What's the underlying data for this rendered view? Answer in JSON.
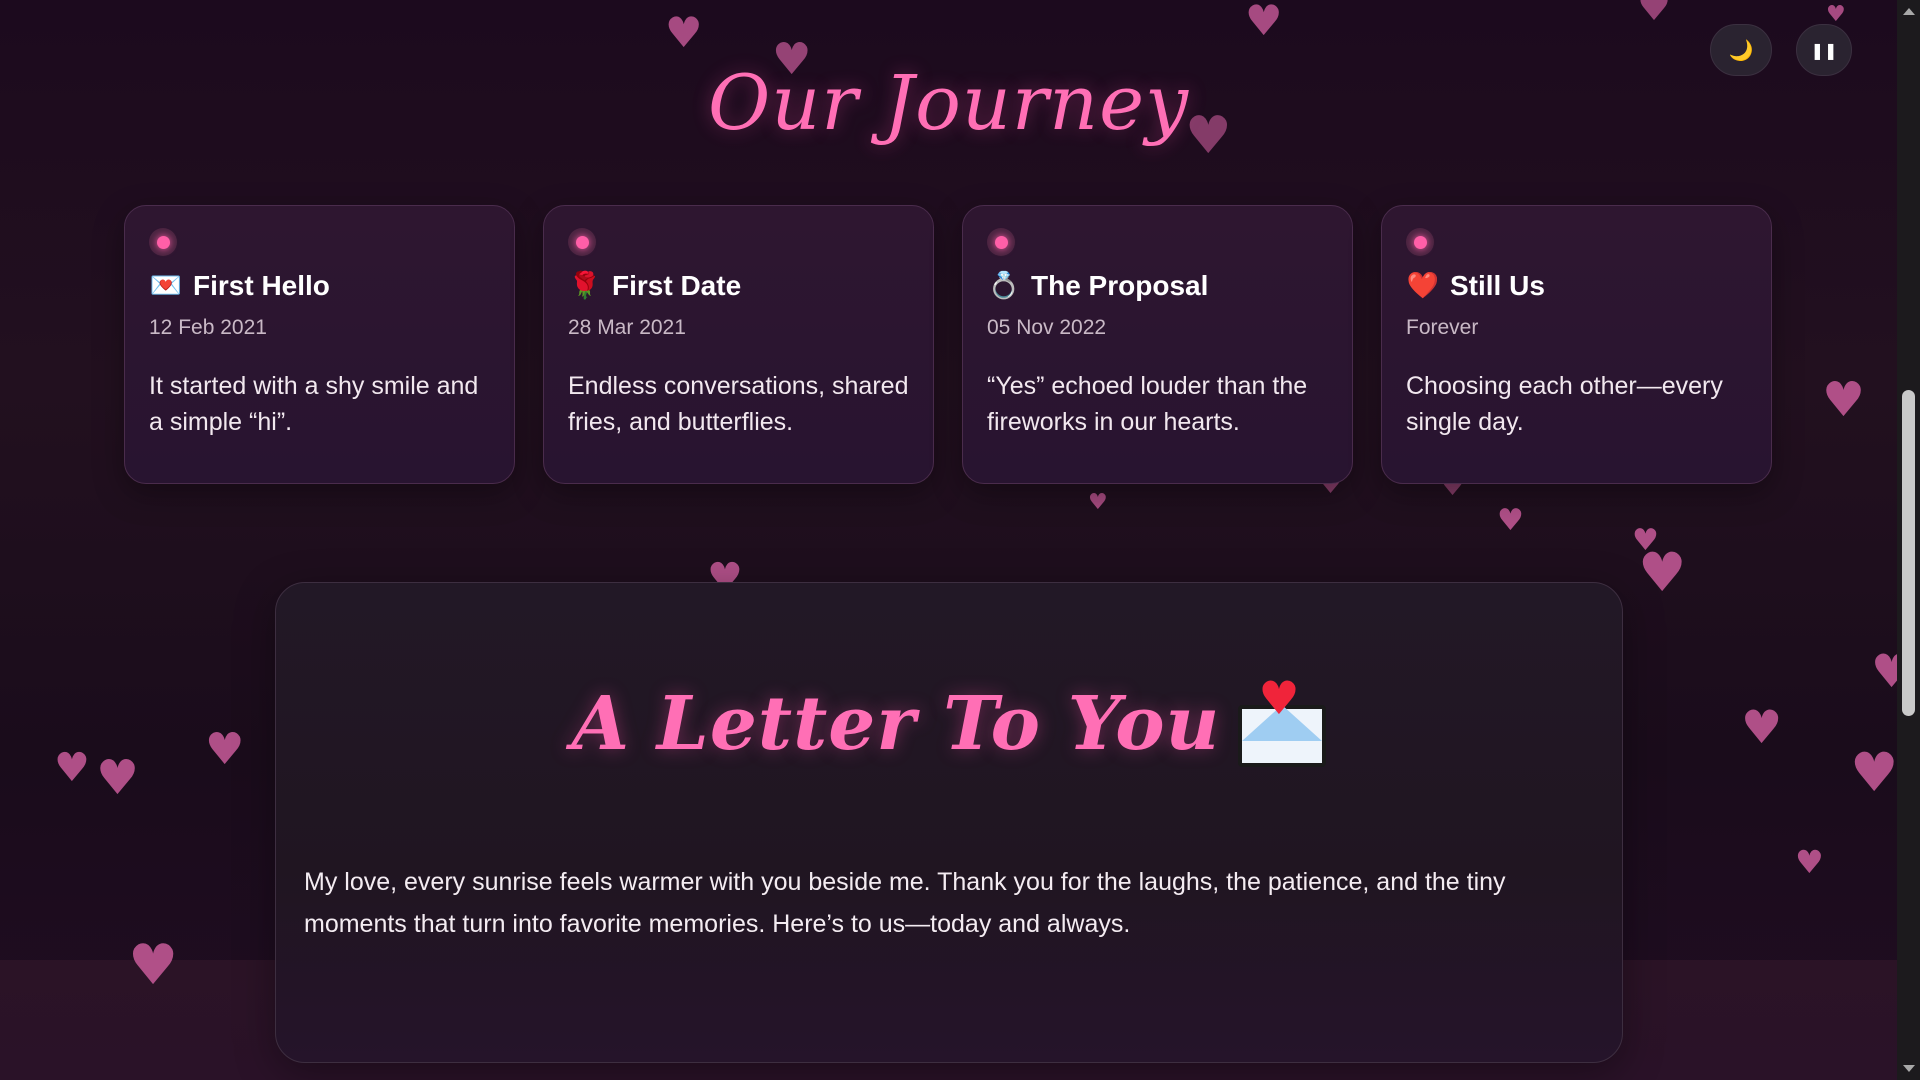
{
  "journey": {
    "title": "Our Journey"
  },
  "controls": {
    "theme_icon": "moon-icon",
    "theme_glyph": "🌙",
    "pause_icon": "pause-icon",
    "pause_glyph": "❚❚"
  },
  "timeline": [
    {
      "emoji": "💌",
      "icon": "love-letter-icon",
      "title": "First Hello",
      "date": "12 Feb 2021",
      "text": "It started with a shy smile and a simple “hi”."
    },
    {
      "emoji": "🌹",
      "icon": "rose-icon",
      "title": "First Date",
      "date": "28 Mar 2021",
      "text": "Endless conversations, shared fries, and butterflies."
    },
    {
      "emoji": "💍",
      "icon": "ring-icon",
      "title": "The Proposal",
      "date": "05 Nov 2022",
      "text": "“Yes” echoed louder than the fireworks in our hearts."
    },
    {
      "emoji": "❤️",
      "icon": "heart-icon",
      "title": "Still Us",
      "date": "Forever",
      "text": "Choosing each other—every single day."
    }
  ],
  "letter": {
    "title": "A Letter To You",
    "icon": "envelope-heart-icon",
    "body": "My love, every sunrise feels warmer with you beside me. Thank you for the laughs, the patience, and the tiny moments that turn into favorite memories. Here’s to us—today and always."
  },
  "colors": {
    "accent": "#ff6fb5",
    "heart": "#c95b9a",
    "background": "#1c0a1e"
  }
}
